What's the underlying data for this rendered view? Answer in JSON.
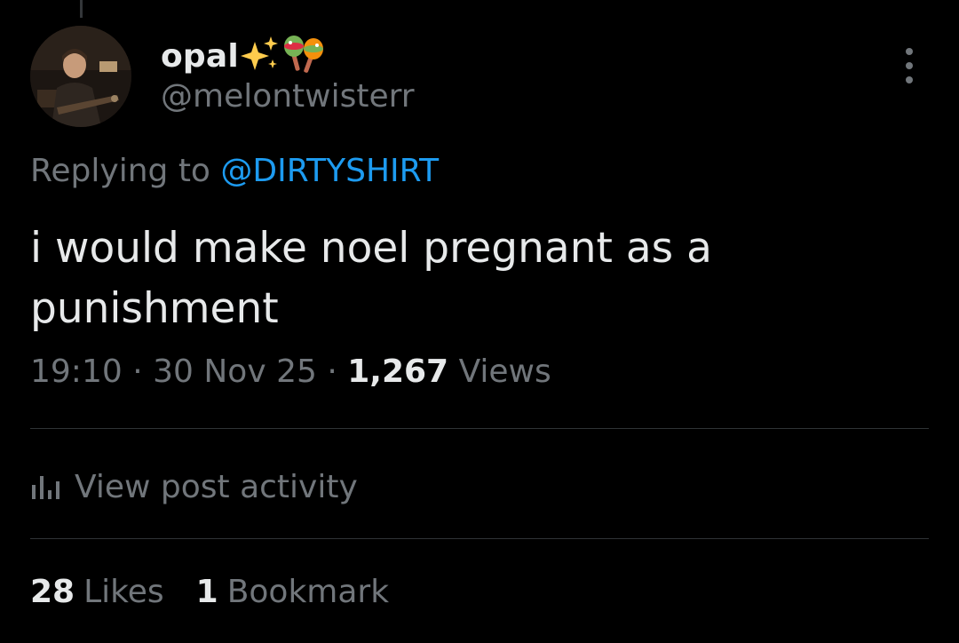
{
  "author": {
    "display_name": "opal",
    "emojis": [
      "sparkles-emoji",
      "maracas-emoji"
    ],
    "handle": "@melontwisterr"
  },
  "reply": {
    "prefix": "Replying to",
    "target": "@DIRTYSHIRT"
  },
  "tweet": {
    "text": "i would make noel pregnant as a punishment",
    "time": "19:10",
    "date": "30 Nov 25",
    "separator": "·",
    "views_count": "1,267",
    "views_label": "Views"
  },
  "activity": {
    "label": "View post activity",
    "icon": "bar-chart-icon"
  },
  "stats": [
    {
      "count": "28",
      "label": "Likes"
    },
    {
      "count": "1",
      "label": "Bookmark"
    }
  ],
  "colors": {
    "background": "#000000",
    "text_primary": "#e7e9ea",
    "text_secondary": "#71767b",
    "link": "#1d9bf0",
    "divider": "#2f3336"
  }
}
